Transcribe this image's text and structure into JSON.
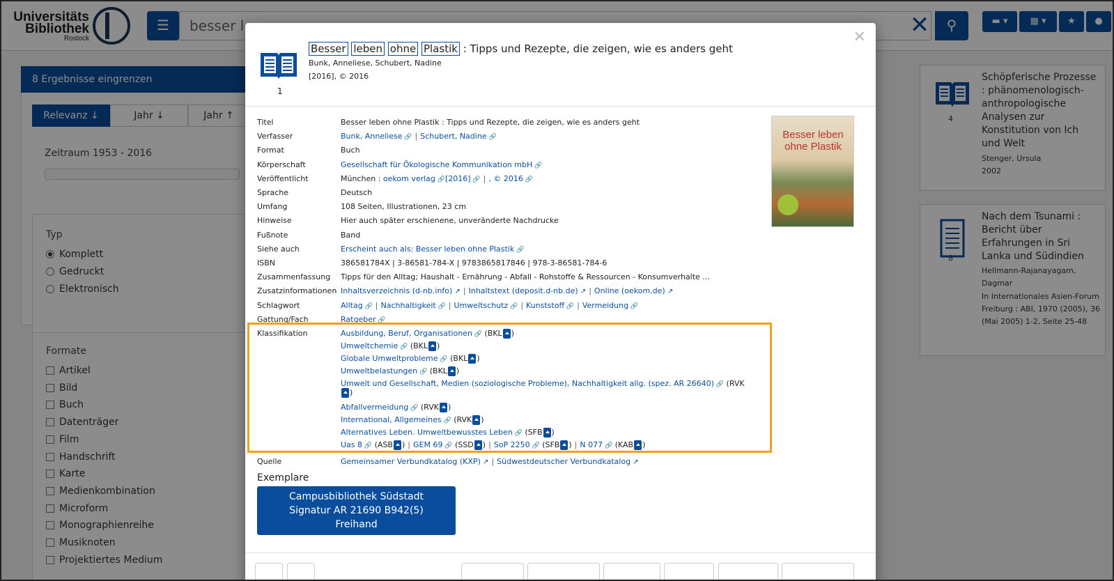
{
  "header": {
    "logo_line1": "Universitäts",
    "logo_line2": "Bibliothek",
    "logo_line3": "Rostock",
    "search_value": "besser le",
    "flag_label": "DE"
  },
  "sidebar": {
    "title": "8 Ergebnisse eingrenzen",
    "sort": [
      {
        "label": "Relevanz ↓"
      },
      {
        "label": "Jahr ↓"
      },
      {
        "label": "Jahr ↑"
      }
    ],
    "range_label": "Zeitraum 1953 - 2016",
    "typ": {
      "title": "Typ",
      "items": [
        {
          "label": "Komplett",
          "checked": true
        },
        {
          "label": "Gedruckt",
          "checked": false
        },
        {
          "label": "Elektronisch",
          "checked": false
        }
      ]
    },
    "formate": {
      "title": "Formate",
      "items": [
        "Artikel",
        "Bild",
        "Buch",
        "Datenträger",
        "Film",
        "Handschrift",
        "Karte",
        "Medienkombination",
        "Microform",
        "Monographienreihe",
        "Musiknoten",
        "Projektiertes Medium"
      ]
    }
  },
  "results": [
    {
      "num": "4",
      "title": "Schöpferische Prozesse : phänomenologisch-anthropologische Analysen zur Konstitution von Ich und Welt",
      "author": "Stenger, Ursula",
      "year": "2002"
    },
    {
      "num": "8",
      "title": "Nach dem Tsunami : Bericht über Erfahrungen in Sri Lanka und Südindien",
      "author": "Hellmann-Rajanayagam, Dagmar",
      "extra": "In Internationales Asien-Forum Freiburg : ABI, 1970 (2005), 36 (Mai 2005) 1-2, Seite 25-48"
    }
  ],
  "modal": {
    "number": "1",
    "title_words": [
      "Besser",
      "leben",
      "ohne",
      "Plastik"
    ],
    "title_rest": " : Tipps und Rezepte, die zeigen, wie es anders geht",
    "authors_line": "Bunk, Anneliese, Schubert, Nadine",
    "date_line": "[2016], © 2016",
    "cover_title": "Besser leben ohne Plastik",
    "labels": {
      "titel": "Titel",
      "verfasser": "Verfasser",
      "format": "Format",
      "koerperschaft": "Körperschaft",
      "veroeffentlicht": "Veröffentlicht",
      "sprache": "Sprache",
      "umfang": "Umfang",
      "hinweise": "Hinweise",
      "fussnote": "Fußnote",
      "siehe_auch": "Siehe auch",
      "isbn": "ISBN",
      "zusammenfassung": "Zusammenfassung",
      "zusatzinfo": "Zusatzinformationen",
      "schlagwort": "Schlagwort",
      "gattung": "Gattung/Fach",
      "klassifikation": "Klassifikation",
      "quelle": "Quelle"
    },
    "values": {
      "titel": "Besser leben ohne Plastik : Tipps und Rezepte, die zeigen, wie es anders geht",
      "verfasser": [
        "Bunk, Anneliese",
        "Schubert, Nadine"
      ],
      "format": "Buch",
      "koerperschaft": "Gesellschaft für Ökologische Kommunikation mbH",
      "veroeffentlicht_prefix": "München : ",
      "veroeffentlicht_links": [
        "oekom verlag",
        "[2016]",
        ", © 2016"
      ],
      "sprache": "Deutsch",
      "umfang": "108 Seiten, Illustrationen, 23 cm",
      "hinweise": "Hier auch später erschienene, unveränderte Nachdrucke",
      "fussnote": "Band",
      "siehe_auch": "Erscheint auch als: Besser leben ohne Plastik",
      "isbn": "386581784X | 3-86581-784-X | 9783865817846 | 978-3-86581-784-6",
      "zusammenfassung": "Tipps für den Alltag; Haushalt - Ernährung - Abfall - Rohstoffe & Ressourcen - Konsumverhalte ...",
      "zusatzinfo": [
        "Inhaltsverzeichnis (d-nb.info)",
        "Inhaltstext (deposit.d-nb.de)",
        "Online (oekom.de)"
      ],
      "schlagwort": [
        "Alltag",
        "Nachhaltigkeit",
        "Umweltschutz",
        "Kunststoff",
        "Vermeidung"
      ],
      "gattung": "Ratgeber",
      "klassifikation": [
        {
          "text": "Ausbildung, Beruf, Organisationen",
          "scheme": "(BKL"
        },
        {
          "text": "Umweltchemie",
          "scheme": "(BKL"
        },
        {
          "text": "Globale Umweltprobleme",
          "scheme": "(BKL"
        },
        {
          "text": "Umweltbelastungen",
          "scheme": "(BKL"
        },
        {
          "text": "Umwelt und Gesellschaft, Medien (soziologische Probleme), Nachhaltigkeit allg. (spez. AR 26640)",
          "scheme": "(RVK"
        },
        {
          "text": "Abfallvermeidung",
          "scheme": "(RVK"
        },
        {
          "text": "International, Allgemeines",
          "scheme": "(RVK"
        },
        {
          "text": "Alternatives Leben. Umweltbewusstes Leben",
          "scheme": "(SFB"
        }
      ],
      "klassifikation_last": [
        {
          "text": "Uas 8",
          "scheme": "(ASB"
        },
        {
          "text": "GEM 69",
          "scheme": "(SSD"
        },
        {
          "text": "SoP 2250",
          "scheme": "(SFB"
        },
        {
          "text": "N 077",
          "scheme": "(KAB"
        }
      ],
      "quelle": [
        "Gemeinsamer Verbundkatalog (KXP)",
        "Südwestdeutscher Verbundkatalog"
      ]
    },
    "exemplare_title": "Exemplare",
    "exemplar_line1": "Campusbibliothek Südstadt",
    "exemplar_line2": "Signatur AR 21690 B942(5)",
    "exemplar_line3": "Freihand"
  }
}
